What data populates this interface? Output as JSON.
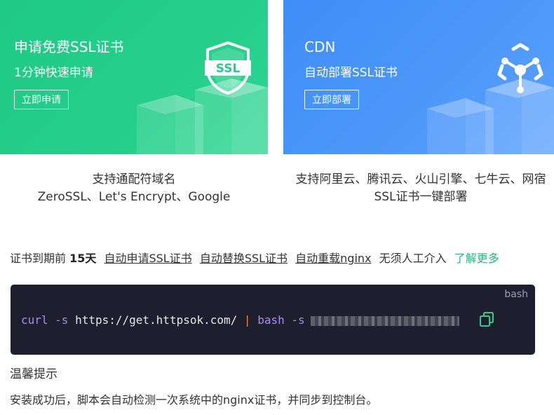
{
  "ssl_card": {
    "title": "申请免费SSL证书",
    "subtitle": "1分钟快速申请",
    "button": "立即申请",
    "badge": "SSL",
    "desc_line1": "支持通配符域名",
    "desc_line2": "ZeroSSL、Let's Encrypt、Google"
  },
  "cdn_card": {
    "title": "CDN",
    "subtitle": "自动部署SSL证书",
    "button": "立即部署",
    "desc_line1": "支持阿里云、腾讯云、火山引擎、七牛云、网宿",
    "desc_line2": "SSL证书一键部署"
  },
  "info": {
    "prefix": "证书到期前",
    "days": "15天",
    "feature1": "自动申请SSL证书",
    "feature2": "自动替换SSL证书",
    "feature3": "自动重载nginx",
    "suffix": "无须人工介入",
    "learn_more": "了解更多"
  },
  "code": {
    "lang": "bash",
    "cmd": "curl",
    "flag1": "-s",
    "url": "https://get.httpsok.com/",
    "pipe": "|",
    "cmd2": "bash",
    "flag2": "-s"
  },
  "tip": {
    "title": "温馨提示",
    "text": "安装成功后，脚本会自动检测一次系统中的nginx证书，并同步到控制台。"
  },
  "colors": {
    "ssl_green": "#25cf8a",
    "cdn_blue": "#4d98fa",
    "link_green": "#1fbe7a",
    "code_bg": "#1e1f2e"
  },
  "icons": {
    "ssl": "ssl-shield-icon",
    "cdn": "cdn-network-icon",
    "copy": "copy-icon"
  }
}
